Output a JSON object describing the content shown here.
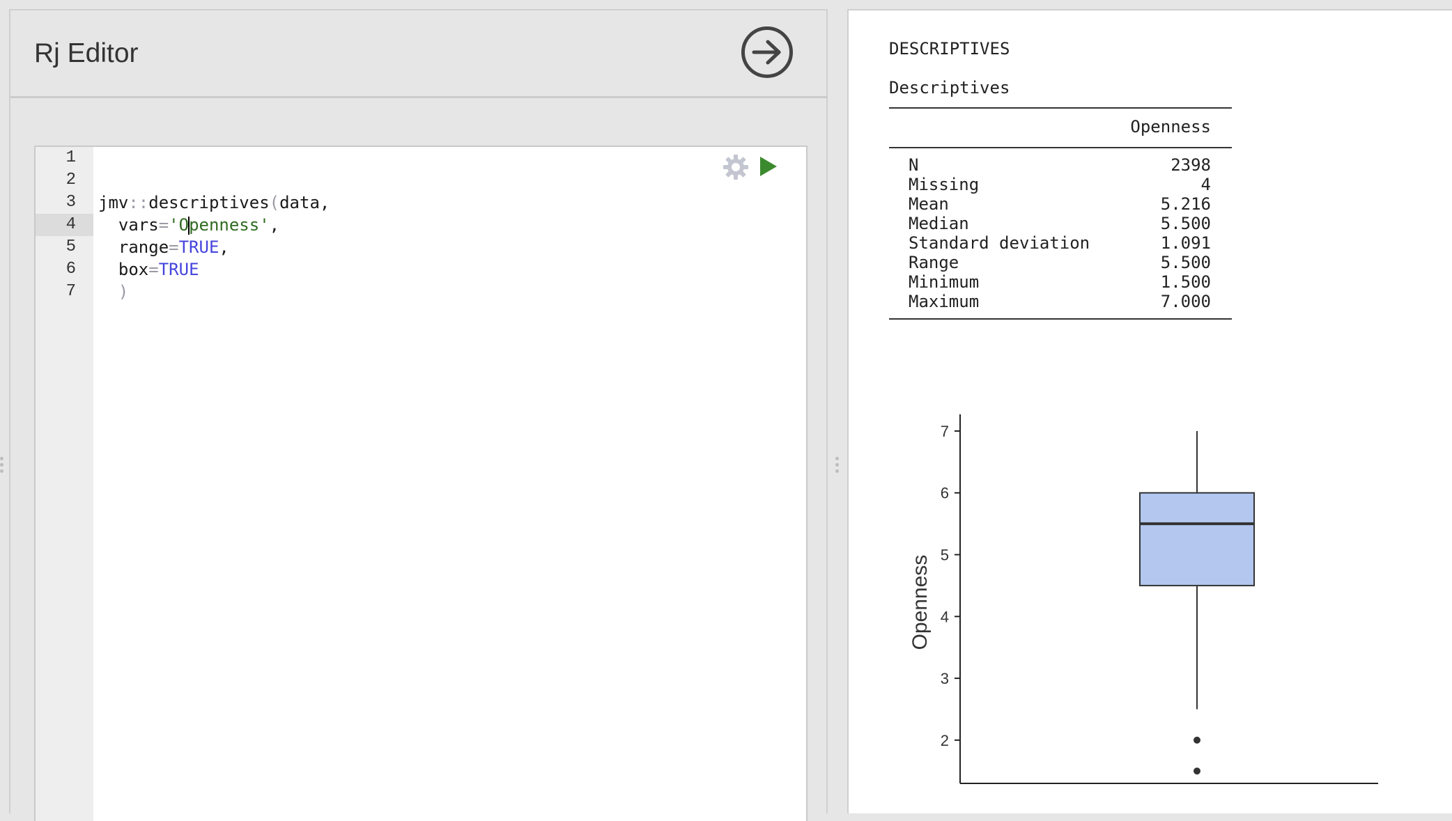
{
  "editor": {
    "title": "Rj Editor",
    "line_numbers": [
      "1",
      "2",
      "3",
      "4",
      "5",
      "6",
      "7"
    ],
    "active_line": 4,
    "code": {
      "line3": {
        "fn_pkg": "jmv",
        "sep": "::",
        "fn_name": "descriptives",
        "paren_open": "(",
        "arg": "data",
        "comma": ","
      },
      "line4": {
        "arg": "vars",
        "eq": "=",
        "str_before_cursor": "'O",
        "str_after_cursor": "penness'",
        "comma": ","
      },
      "line5": {
        "arg": "range",
        "eq": "=",
        "kw": "TRUE",
        "comma": ","
      },
      "line6": {
        "arg": "box",
        "eq": "=",
        "kw": "TRUE"
      },
      "line7": {
        "paren_close": ")"
      }
    },
    "icons": {
      "run_arrow": "arrow-right-circle-icon",
      "settings": "gear-icon",
      "run": "play-icon"
    }
  },
  "results": {
    "heading": "DESCRIPTIVES",
    "table": {
      "title": "Descriptives",
      "column_header": "Openness",
      "rows": [
        {
          "label": "N",
          "value": "2398"
        },
        {
          "label": "Missing",
          "value": "4"
        },
        {
          "label": "Mean",
          "value": "5.216"
        },
        {
          "label": "Median",
          "value": "5.500"
        },
        {
          "label": "Standard deviation",
          "value": "1.091"
        },
        {
          "label": "Range",
          "value": "5.500"
        },
        {
          "label": "Minimum",
          "value": "1.500"
        },
        {
          "label": "Maximum",
          "value": "7.000"
        }
      ]
    }
  },
  "chart_data": {
    "type": "box",
    "ylabel": "Openness",
    "y_ticks": [
      2,
      3,
      4,
      5,
      6,
      7
    ],
    "ylim": [
      1.3,
      7.27
    ],
    "box": {
      "q1": 4.5,
      "median": 5.5,
      "q3": 6.0,
      "whisker_low": 2.5,
      "whisker_high": 7.0
    },
    "outliers": [
      2.0,
      1.5
    ],
    "fill_color": "#b3c7ef",
    "stroke_color": "#333333"
  }
}
